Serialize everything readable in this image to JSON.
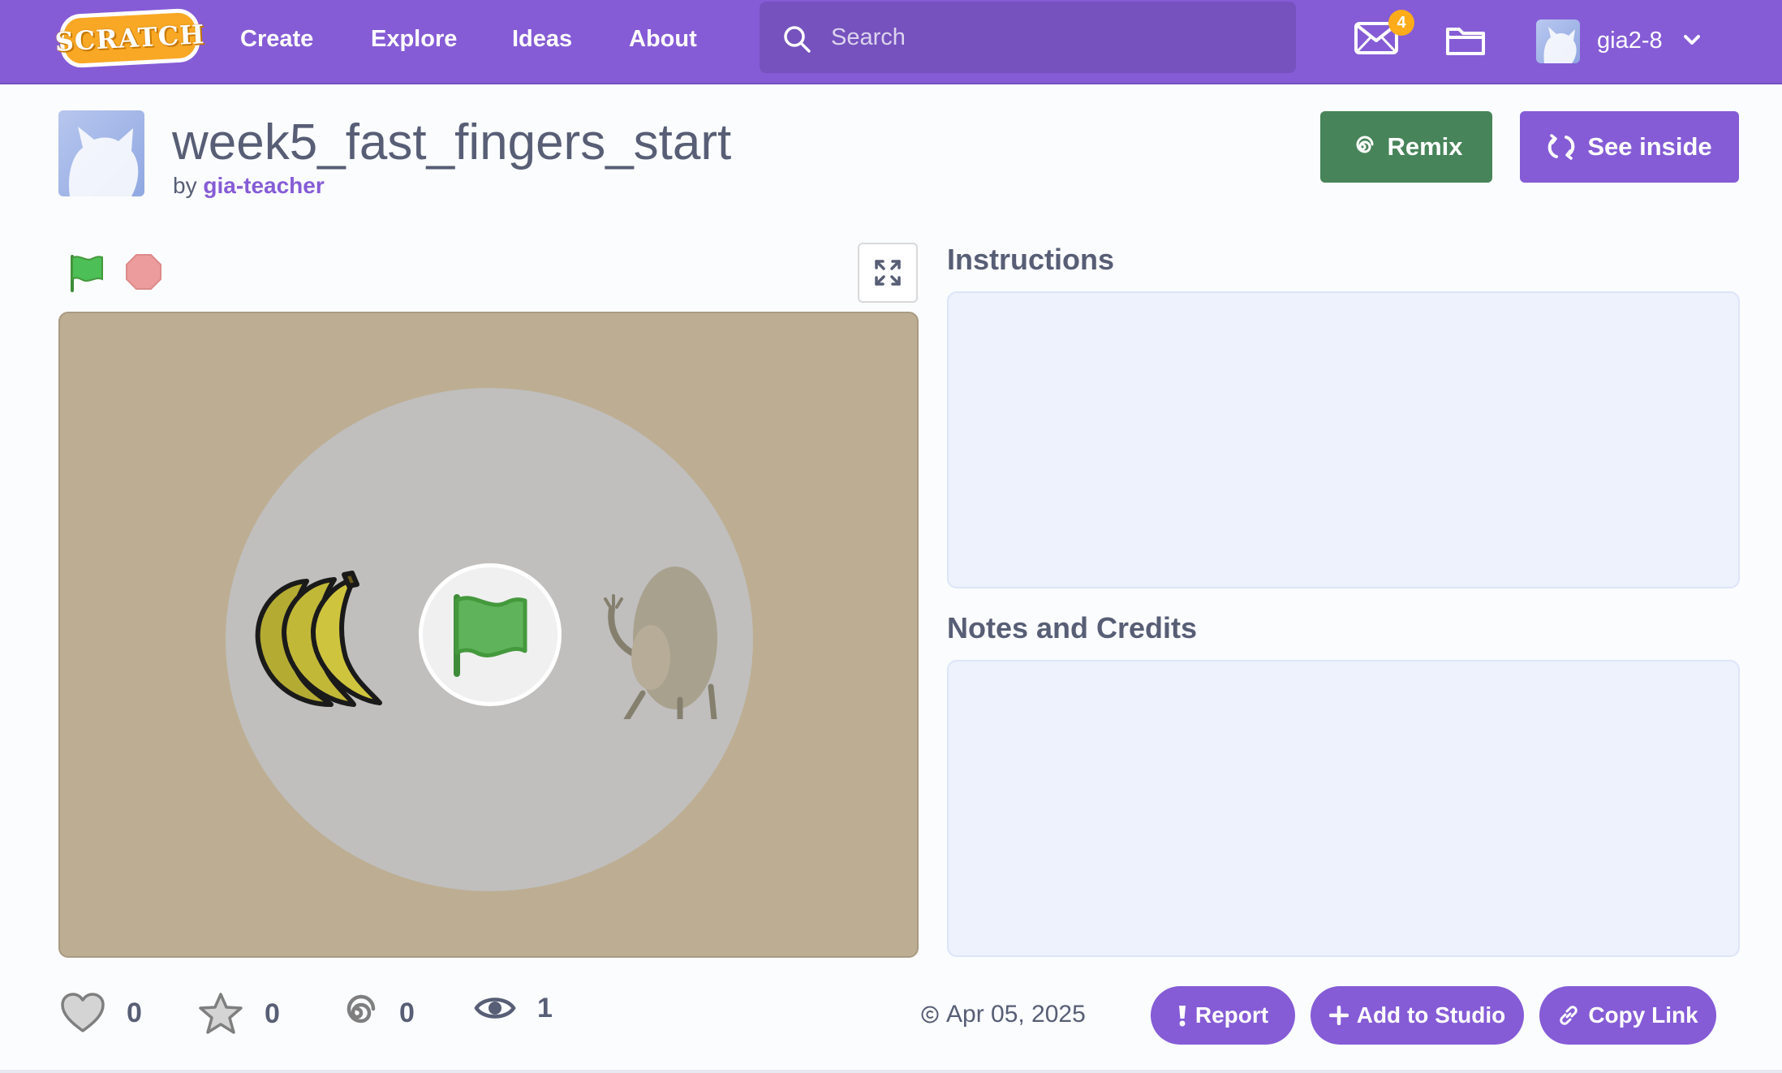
{
  "nav": {
    "logo_text": "SCRATCH",
    "links": [
      "Create",
      "Explore",
      "Ideas",
      "About"
    ],
    "search_placeholder": "Search",
    "messages_count": "4",
    "username": "gia2-8"
  },
  "project": {
    "title": "week5_fast_fingers_start",
    "by_label": "by",
    "author": "gia-teacher",
    "remix_label": "Remix",
    "see_inside_label": "See inside"
  },
  "sections": {
    "instructions_title": "Instructions",
    "notes_title": "Notes and Credits"
  },
  "stats": {
    "loves": "0",
    "favorites": "0",
    "remixes": "0",
    "views": "1"
  },
  "footer": {
    "date": "Apr 05, 2025",
    "report_label": "Report",
    "add_to_studio_label": "Add to Studio",
    "copy_link_label": "Copy Link"
  },
  "colors": {
    "brand": "#855cd6",
    "remix": "#478459",
    "stage": "#bdae93",
    "textbox": "#edf2fc"
  }
}
